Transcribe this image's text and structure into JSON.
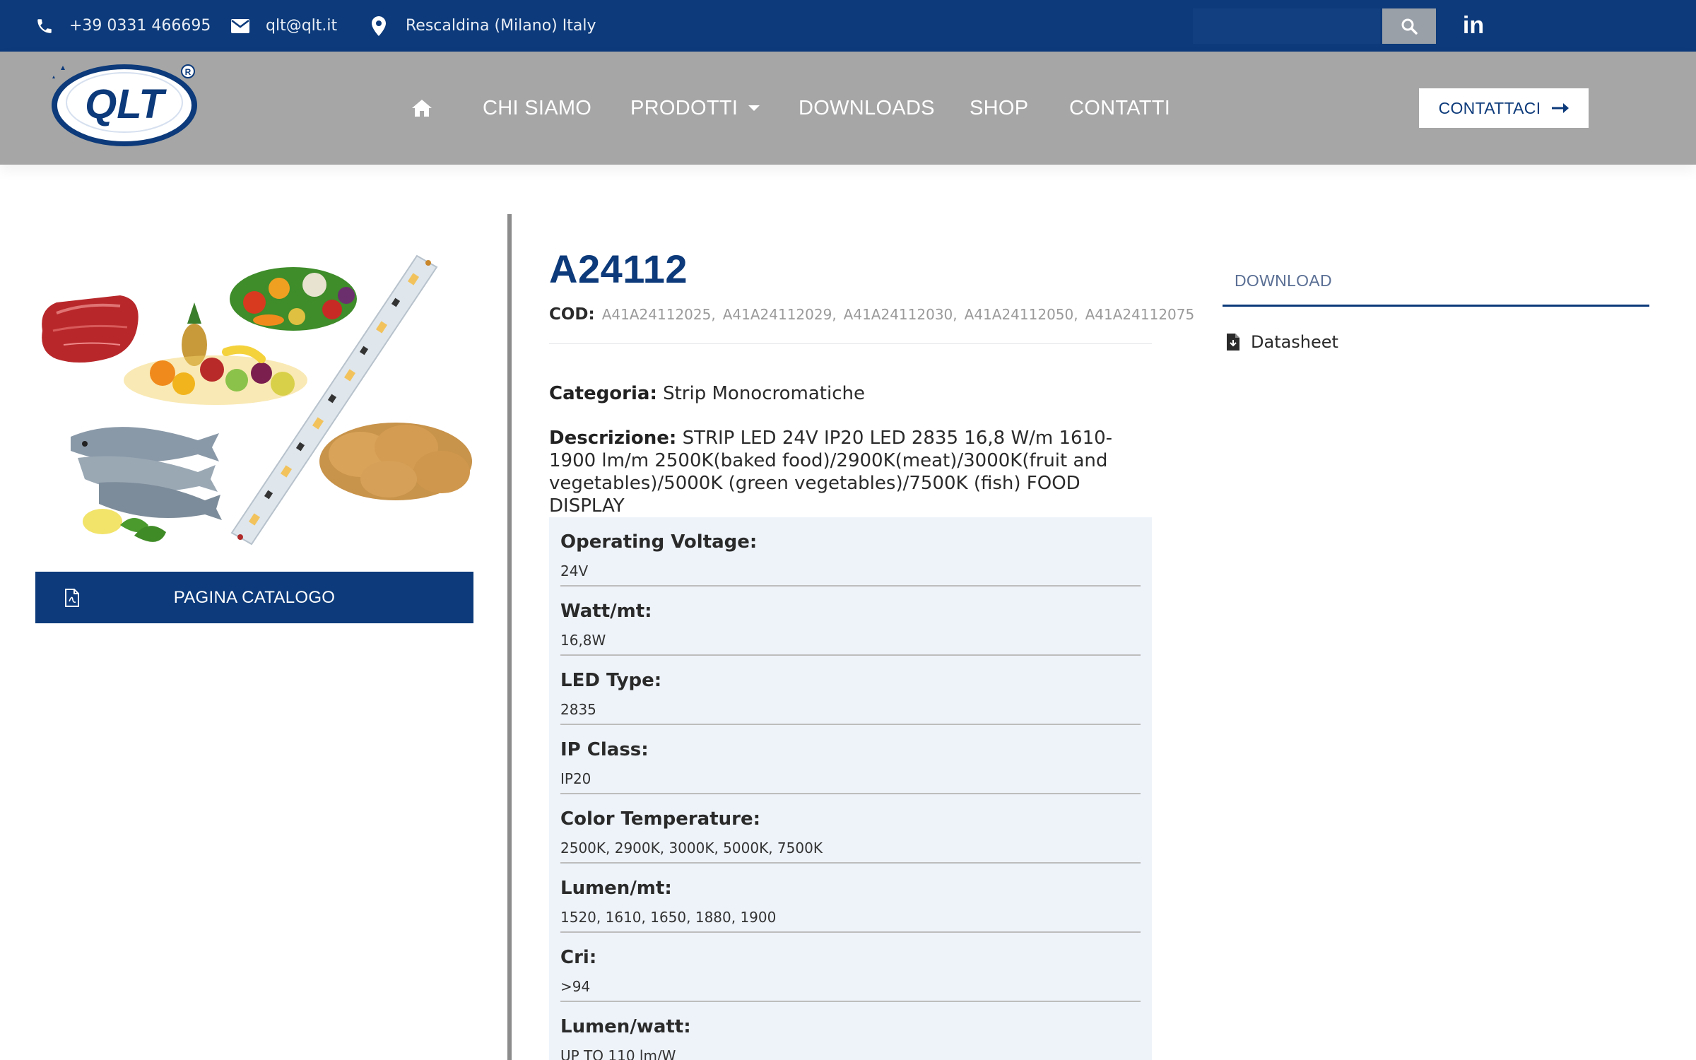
{
  "topbar": {
    "phone": "+39 0331 466695",
    "email": "qlt@qlt.it",
    "location": "Rescaldina (Milano) Italy",
    "search_placeholder": "",
    "icons": [
      "phone-icon",
      "envelope-icon",
      "map-pin-icon",
      "search-icon",
      "linkedin-icon"
    ]
  },
  "header": {
    "logo_text": "QLT",
    "nav": [
      "CHI SIAMO",
      "PRODOTTI",
      "DOWNLOADS",
      "SHOP",
      "CONTATTI"
    ],
    "cta_label": "CONTATTACI",
    "colors": {
      "primary": "#0c3a7a",
      "header_bg": "#a6a6a6",
      "spec_bg": "#eef3fa"
    }
  },
  "left": {
    "catalog_label": "PAGINA CATALOGO"
  },
  "product": {
    "title": "A24112",
    "cod_label": "COD:",
    "codes": [
      "A41A24112025",
      "A41A24112029",
      "A41A24112030",
      "A41A24112050",
      "A41A24112075"
    ],
    "category_label": "Categoria:",
    "category": "Strip Monocromatiche",
    "description_label": "Descrizione:",
    "description": "STRIP LED 24V IP20 LED 2835 16,8 W/m 1610-1900 lm/m 2500K(baked food)/2900K(meat)/3000K(fruit and vegetables)/5000K (green vegetables)/7500K (fish) FOOD DISPLAY",
    "specs": [
      {
        "label": "Operating Voltage:",
        "value": "24V"
      },
      {
        "label": "Watt/mt:",
        "value": "16,8W"
      },
      {
        "label": "LED Type:",
        "value": "2835"
      },
      {
        "label": "IP Class:",
        "value": "IP20"
      },
      {
        "label": "Color Temperature:",
        "value": "2500K, 2900K, 3000K, 5000K, 7500K"
      },
      {
        "label": "Lumen/mt:",
        "value": "1520, 1610, 1650, 1880, 1900"
      },
      {
        "label": "Cri:",
        "value": ">94"
      },
      {
        "label": "Lumen/watt:",
        "value": "UP TO 110 lm/W"
      }
    ]
  },
  "downloads": {
    "tab_label": "DOWNLOAD",
    "items": [
      "Datasheet"
    ]
  }
}
